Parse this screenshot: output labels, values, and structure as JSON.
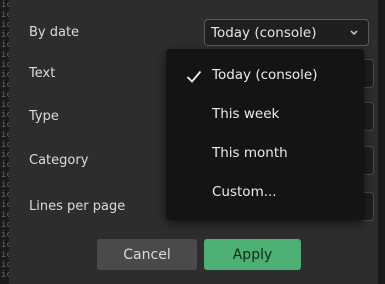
{
  "form": {
    "by_date_label": "By date",
    "text_label": "Text",
    "type_label": "Type",
    "category_label": "Category",
    "lines_label": "Lines per page"
  },
  "date_select": {
    "value": "Today (console)",
    "icon": "chevron-down-icon"
  },
  "date_menu": {
    "items": [
      {
        "label": "Today (console)",
        "selected": true
      },
      {
        "label": "This week",
        "selected": false
      },
      {
        "label": "This month",
        "selected": false
      },
      {
        "label": "Custom...",
        "selected": false
      }
    ]
  },
  "buttons": {
    "cancel_label": "Cancel",
    "apply_label": "Apply"
  },
  "colors": {
    "dialog_bg": "#2d2d2d",
    "menu_bg": "#141414",
    "apply_green": "#4caf73",
    "cancel_gray": "#4a4a4a"
  }
}
